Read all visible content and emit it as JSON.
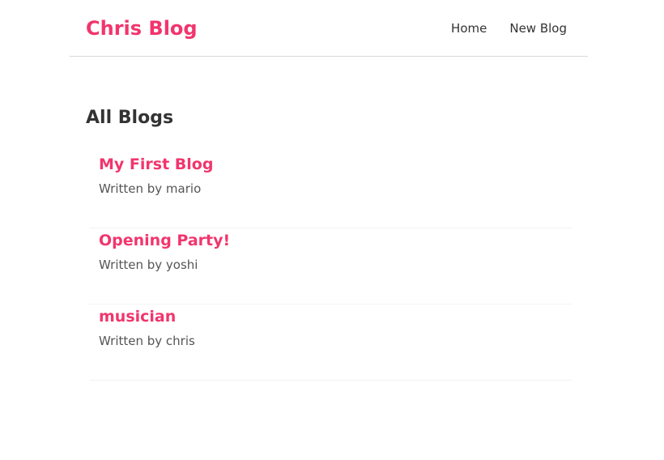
{
  "navbar": {
    "brand": "Chris Blog",
    "links": [
      {
        "label": "Home"
      },
      {
        "label": "New Blog"
      }
    ]
  },
  "main": {
    "title": "All Blogs",
    "blogs": [
      {
        "title": "My First Blog",
        "author": "Written by mario"
      },
      {
        "title": "Opening Party!",
        "author": "Written by yoshi"
      },
      {
        "title": "musician",
        "author": "Written by chris"
      }
    ]
  },
  "colors": {
    "accent": "#f1356d",
    "text": "#333333"
  }
}
